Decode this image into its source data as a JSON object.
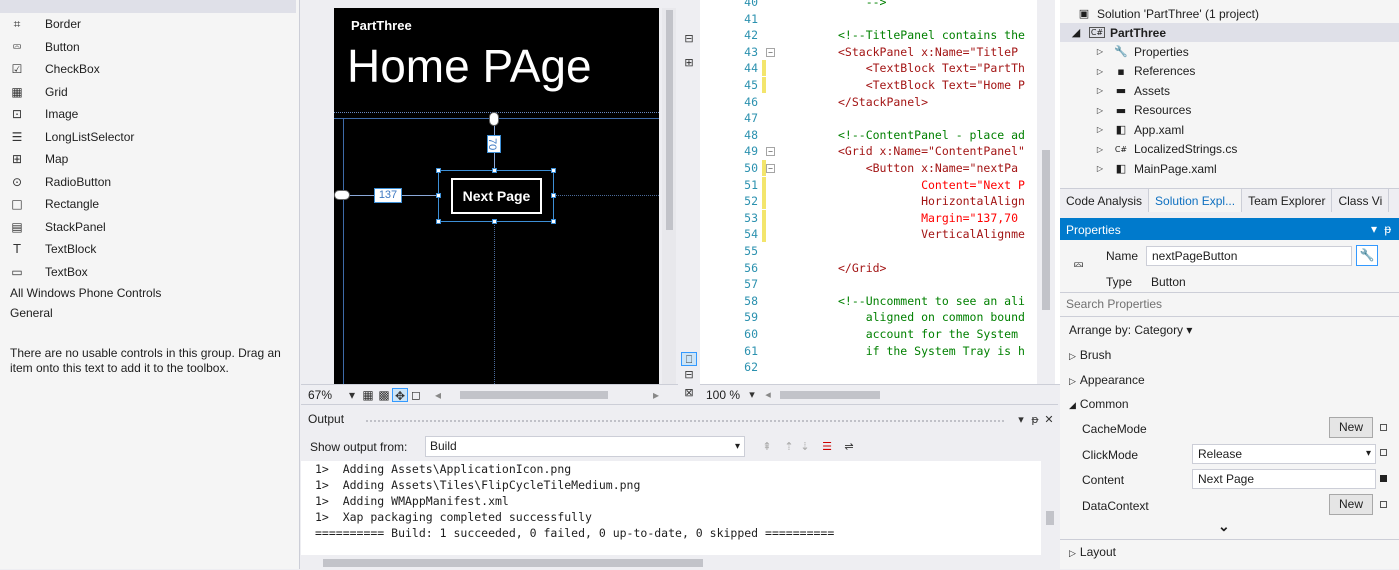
{
  "toolbox": {
    "items": [
      {
        "label": "Border",
        "icon": "border-icon"
      },
      {
        "label": "Button",
        "icon": "button-icon"
      },
      {
        "label": "CheckBox",
        "icon": "checkbox-icon"
      },
      {
        "label": "Grid",
        "icon": "grid-icon"
      },
      {
        "label": "Image",
        "icon": "image-icon"
      },
      {
        "label": "LongListSelector",
        "icon": "list-icon"
      },
      {
        "label": "Map",
        "icon": "map-icon"
      },
      {
        "label": "RadioButton",
        "icon": "radio-icon"
      },
      {
        "label": "Rectangle",
        "icon": "rectangle-icon"
      },
      {
        "label": "StackPanel",
        "icon": "stackpanel-icon"
      },
      {
        "label": "TextBlock",
        "icon": "textblock-icon"
      },
      {
        "label": "TextBox",
        "icon": "textbox-icon"
      }
    ],
    "groups": [
      "All Windows Phone Controls",
      "General"
    ],
    "note": "There are no usable controls in this group. Drag an item onto this text to add it to the toolbox."
  },
  "designer": {
    "app_name": "PartThree",
    "page_title": "Home PAge",
    "button_text": "Next Page",
    "margin_top": "70",
    "margin_left": "137",
    "zoom": "67%"
  },
  "editor": {
    "zoom": "100 %",
    "lines": [
      {
        "n": "40",
        "t": "    -->"
      },
      {
        "n": "41",
        "t": ""
      },
      {
        "n": "42",
        "t": "<!--TitlePanel contains the"
      },
      {
        "n": "43",
        "t": "<StackPanel x:Name=\"TitleP"
      },
      {
        "n": "44",
        "t": "    <TextBlock Text=\"PartTh"
      },
      {
        "n": "45",
        "t": "    <TextBlock Text=\"Home P"
      },
      {
        "n": "46",
        "t": "</StackPanel>"
      },
      {
        "n": "47",
        "t": ""
      },
      {
        "n": "48",
        "t": "<!--ContentPanel - place ad"
      },
      {
        "n": "49",
        "t": "<Grid x:Name=\"ContentPanel\""
      },
      {
        "n": "50",
        "t": "    <Button x:Name=\"nextPa"
      },
      {
        "n": "51",
        "t": "            Content=\"Next P"
      },
      {
        "n": "52",
        "t": "            HorizontalAlign"
      },
      {
        "n": "53",
        "t": "            Margin=\"137,70"
      },
      {
        "n": "54",
        "t": "            VerticalAlignme"
      },
      {
        "n": "55",
        "t": ""
      },
      {
        "n": "56",
        "t": "</Grid>"
      },
      {
        "n": "57",
        "t": ""
      },
      {
        "n": "58",
        "t": "<!--Uncomment to see an ali"
      },
      {
        "n": "59",
        "t": "    aligned on common bound"
      },
      {
        "n": "60",
        "t": "    account for the System "
      },
      {
        "n": "61",
        "t": "    if the System Tray is h"
      },
      {
        "n": "62",
        "t": ""
      }
    ]
  },
  "output": {
    "title": "Output",
    "show_from_label": "Show output from:",
    "show_from_value": "Build",
    "lines": [
      "1>  Adding Assets\\ApplicationIcon.png",
      "1>  Adding Assets\\Tiles\\FlipCycleTileMedium.png",
      "1>  Adding WMAppManifest.xml",
      "1>  Xap packaging completed successfully",
      "========== Build: 1 succeeded, 0 failed, 0 up-to-date, 0 skipped =========="
    ]
  },
  "solution": {
    "root": "Solution 'PartThree' (1 project)",
    "project": "PartThree",
    "items": [
      "Properties",
      "References",
      "Assets",
      "Resources",
      "App.xaml",
      "LocalizedStrings.cs",
      "MainPage.xaml"
    ],
    "tabs": [
      "Code Analysis",
      "Solution Expl...",
      "Team Explorer",
      "Class Vi"
    ]
  },
  "properties": {
    "header": "Properties",
    "name_label": "Name",
    "name_value": "nextPageButton",
    "type_label": "Type",
    "type_value": "Button",
    "search_placeholder": "Search Properties",
    "arrange": "Arrange by: Category",
    "sections": [
      "Brush",
      "Appearance",
      "Common",
      "Layout"
    ],
    "rows": [
      {
        "label": "CacheMode",
        "kind": "new",
        "value": "New"
      },
      {
        "label": "ClickMode",
        "kind": "select",
        "value": "Release"
      },
      {
        "label": "Content",
        "kind": "text",
        "value": "Next Page"
      },
      {
        "label": "DataContext",
        "kind": "new",
        "value": "New"
      }
    ]
  }
}
